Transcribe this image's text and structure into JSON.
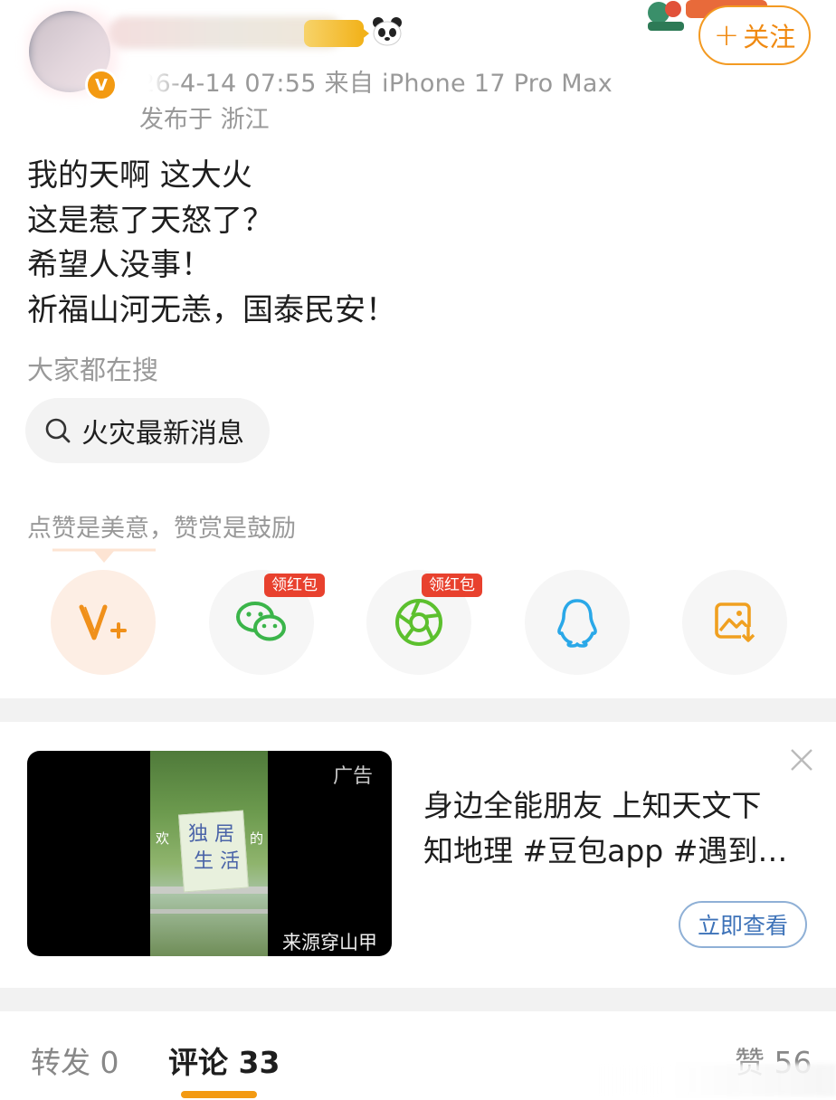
{
  "header": {
    "meta_line1": "26-4-14 07:55  来自 iPhone 17 Pro Max",
    "meta_line2": "发布于 浙江",
    "follow_label": "关注",
    "verified_badge": "V"
  },
  "post": {
    "lines": [
      "我的天啊 这大火",
      "这是惹了天怒了？",
      "希望人没事！",
      "祈福山河无恙，国泰民安！"
    ]
  },
  "hot_search": {
    "title": "大家都在搜",
    "chip_label": "火灾最新消息"
  },
  "reward": {
    "tip": "点赞是美意，赞赏是鼓励"
  },
  "share": {
    "buttons": [
      {
        "icon": "v-plus-reward-icon"
      },
      {
        "icon": "wechat-icon",
        "tag": "领红包"
      },
      {
        "icon": "moments-icon",
        "tag": "领红包"
      },
      {
        "icon": "qq-icon"
      },
      {
        "icon": "save-image-icon"
      }
    ]
  },
  "ad": {
    "label": "广告",
    "source": "来源穿山甲",
    "overlay_left": "欢",
    "overlay_right": "的",
    "sign_line1": "独 居",
    "sign_line2": "生 活",
    "text_line1": "身边全能朋友 上知天文下",
    "text_line2": "知地理 #豆包app #遇到…",
    "cta": "立即查看"
  },
  "tabs": {
    "repost": "转发 0",
    "comment": "评论 33",
    "likes": "赞 56"
  },
  "colors": {
    "accent": "#f39a12",
    "follow_border": "#f39a22",
    "redtag": "#e8412e",
    "link_blue": "#3d72b8"
  }
}
